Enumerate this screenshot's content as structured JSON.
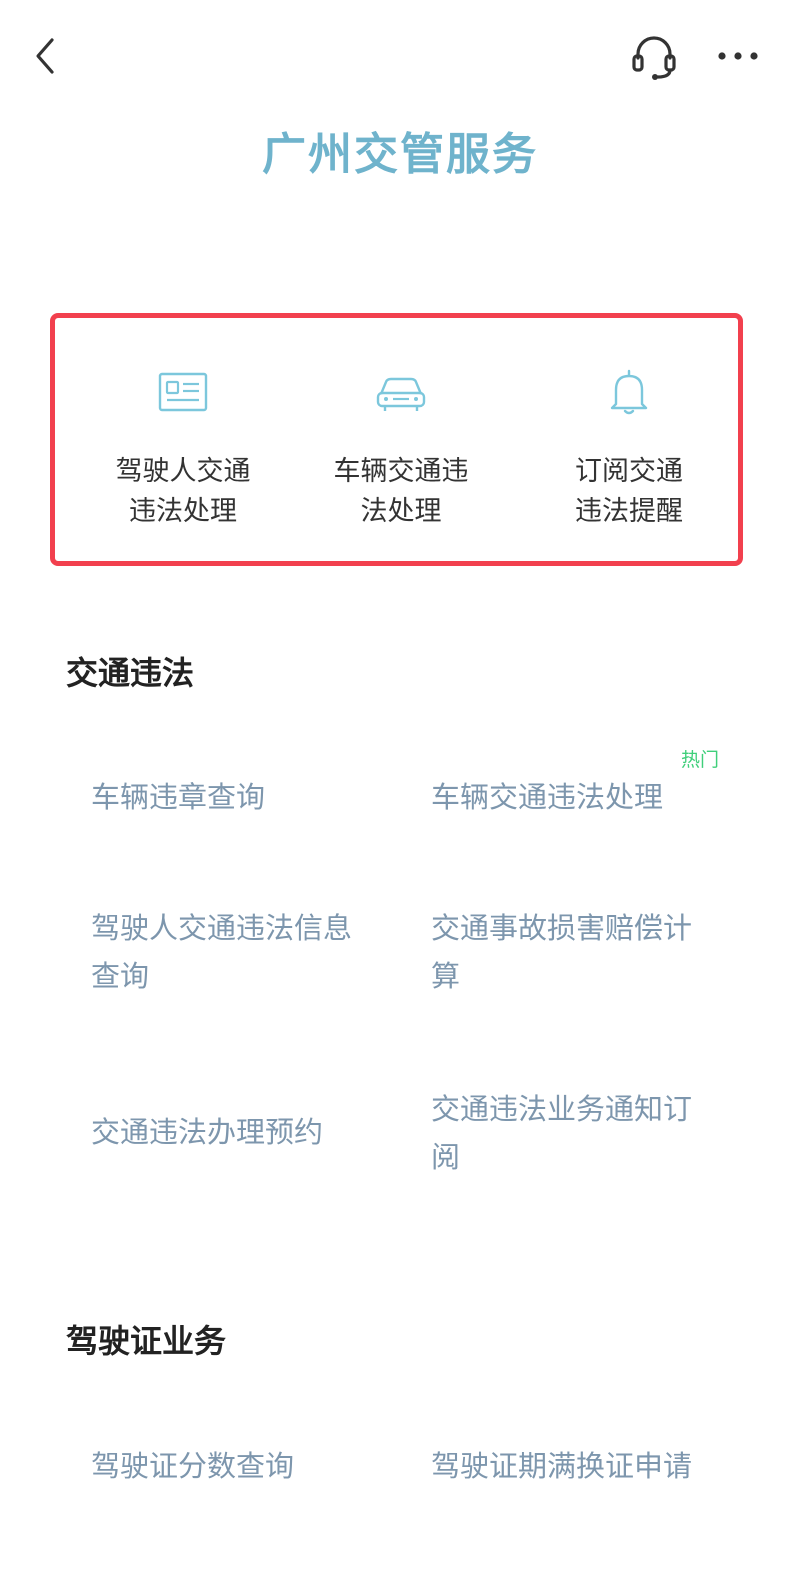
{
  "header": {
    "back_icon": "chevron-left-icon",
    "support_icon": "headset-icon",
    "more_icon": "more-dots-icon",
    "title": "广州交管服务",
    "title_color": "#6fb3cc"
  },
  "quick_actions": {
    "border_color": "#f2404e",
    "icon_color": "#7cc7dc",
    "items": [
      {
        "icon": "id-card-icon",
        "label_line1": "驾驶人交通",
        "label_line2": "违法处理"
      },
      {
        "icon": "car-icon",
        "label_line1": "车辆交通违",
        "label_line2": "法处理"
      },
      {
        "icon": "bell-icon",
        "label_line1": "订阅交通",
        "label_line2": "违法提醒"
      }
    ]
  },
  "traffic_violation": {
    "title": "交通违法",
    "hot_badge": "热门",
    "hot_color": "#3fcf7a",
    "items": [
      {
        "line1": "车辆违章查询",
        "line2": ""
      },
      {
        "line1": "车辆交通违法处理",
        "line2": ""
      },
      {
        "line1": "驾驶人交通违法信息",
        "line2": "查询"
      },
      {
        "line1": "交通事故损害赔偿计",
        "line2": "算"
      },
      {
        "line1": "交通违法办理预约",
        "line2": ""
      },
      {
        "line1": "交通违法业务通知订",
        "line2": "阅"
      }
    ]
  },
  "license_business": {
    "title": "驾驶证业务",
    "items": [
      {
        "line1": "驾驶证分数查询"
      },
      {
        "line1": "驾驶证期满换证申请"
      }
    ]
  },
  "link_color": "#7d96ad"
}
